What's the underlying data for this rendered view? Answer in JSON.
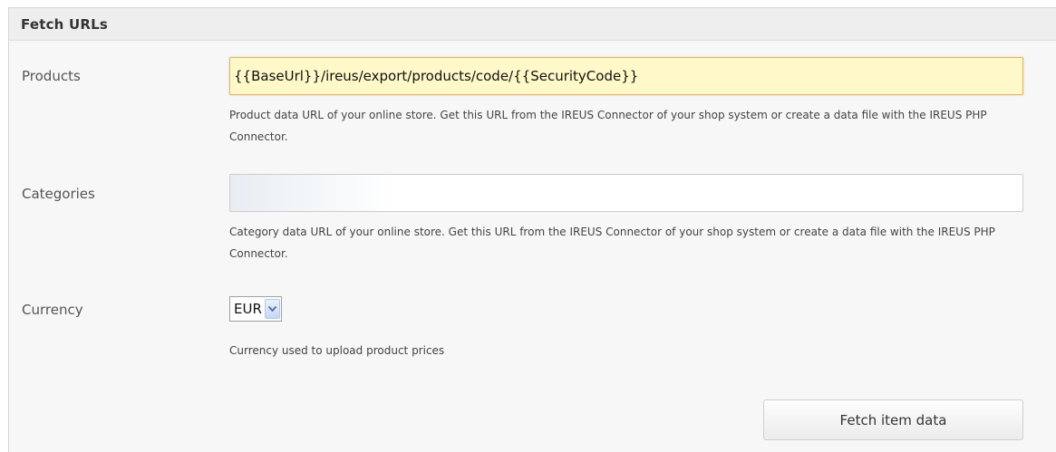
{
  "panel": {
    "title": "Fetch URLs"
  },
  "fields": {
    "products": {
      "label": "Products",
      "value": "{{BaseUrl}}/ireus/export/products/code/{{SecurityCode}}",
      "help": "Product data URL of your online store. Get this URL from the IREUS Connector of your shop system or create a data file with the IREUS PHP Connector."
    },
    "categories": {
      "label": "Categories",
      "value": "",
      "help": "Category data URL of your online store. Get this URL from the IREUS Connector of your shop system or create a data file with the IREUS PHP Connector."
    },
    "currency": {
      "label": "Currency",
      "selected": "EUR",
      "help": "Currency used to upload product prices",
      "arrow_icon": "chevron-down-icon"
    }
  },
  "actions": {
    "fetch_label": "Fetch item data"
  },
  "colors": {
    "focused_input_bg": "#fff8c8",
    "focused_input_border": "#e2b26a",
    "select_arrow_bg": "#c6d7f4"
  }
}
